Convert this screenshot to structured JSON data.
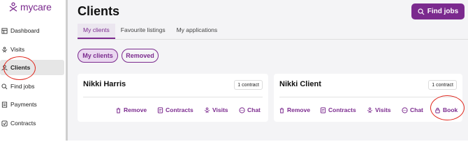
{
  "brand": {
    "name": "mycare",
    "color": "#7b2a8e"
  },
  "sidebar": {
    "items": [
      {
        "label": "Dashboard",
        "icon": "grid-icon"
      },
      {
        "label": "Visits",
        "icon": "visits-icon"
      },
      {
        "label": "Clients",
        "icon": "clients-icon",
        "active": true
      },
      {
        "label": "Find jobs",
        "icon": "search-icon"
      },
      {
        "label": "Payments",
        "icon": "payments-icon"
      },
      {
        "label": "Contracts",
        "icon": "contracts-icon"
      }
    ]
  },
  "header": {
    "title": "Clients",
    "find_jobs_label": "Find jobs"
  },
  "tabs": [
    {
      "label": "My clients",
      "active": true
    },
    {
      "label": "Favourite listings"
    },
    {
      "label": "My applications"
    }
  ],
  "filters": [
    {
      "label": "My clients",
      "selected": true
    },
    {
      "label": "Removed"
    }
  ],
  "cards": [
    {
      "name": "Nikki Harris",
      "badge": "1 contract",
      "actions": {
        "remove": "Remove",
        "contracts": "Contracts",
        "visits": "Visits",
        "chat": "Chat"
      }
    },
    {
      "name": "Nikki Client",
      "badge": "1 contract",
      "actions": {
        "remove": "Remove",
        "contracts": "Contracts",
        "visits": "Visits",
        "chat": "Chat",
        "book": "Book"
      }
    }
  ],
  "annotation_color": "#e0271d"
}
